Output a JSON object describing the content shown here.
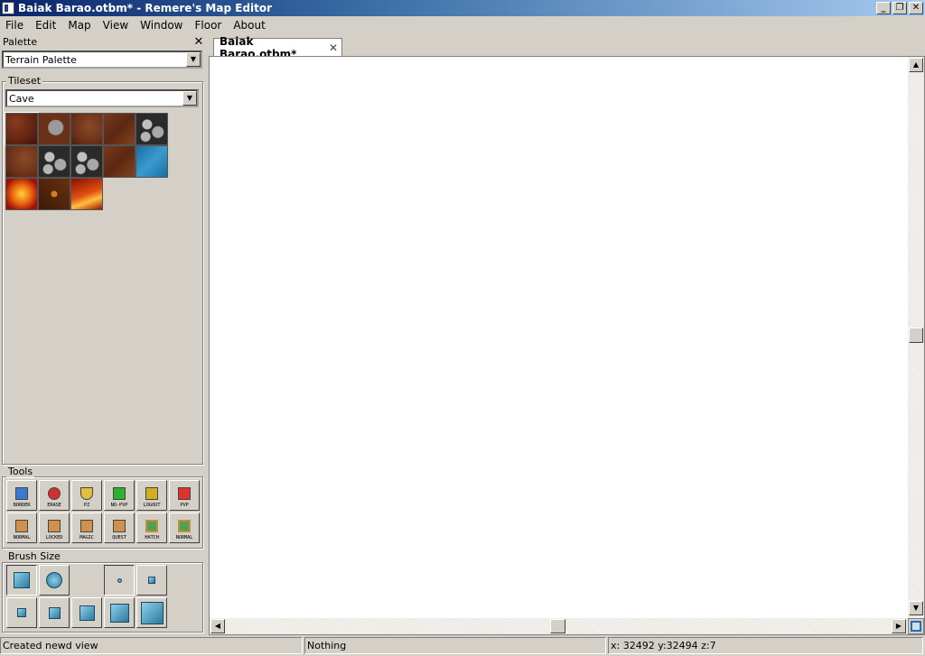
{
  "window": {
    "title": "Baiak Barao.otbm* - Remere's Map Editor",
    "min_glyph": "_",
    "max_glyph": "❐",
    "close_glyph": "✕"
  },
  "menu": [
    "File",
    "Edit",
    "Map",
    "View",
    "Window",
    "Floor",
    "About"
  ],
  "palette": {
    "title": "Palette",
    "close_glyph": "✕",
    "selector_value": "Terrain Palette",
    "tileset_label": "Tileset",
    "tileset_value": "Cave",
    "dropdown_glyph": "▼",
    "tiles": [
      "cave-dirt",
      "cave-rock-dirt",
      "cave-dirt-2",
      "cave-dirt-cracked",
      "cave-rock",
      "cave-dirt-3",
      "cave-rock-2",
      "cave-rock-3",
      "cave-dirt-4",
      "water",
      "lava",
      "lava-cracked",
      "lava-2"
    ]
  },
  "tools": {
    "label": "Tools",
    "buttons": [
      {
        "label": "BORDER",
        "icon": "border-icon",
        "color": "#3a7ad0"
      },
      {
        "label": "ERASE",
        "icon": "eraser-icon",
        "color": "#d03030"
      },
      {
        "label": "PZ",
        "icon": "shield-icon",
        "color": "#e0c040"
      },
      {
        "label": "NO-PVP",
        "icon": "green-flag-icon",
        "color": "#30b030"
      },
      {
        "label": "LOGOUT",
        "icon": "lock-icon",
        "color": "#d0b020"
      },
      {
        "label": "PVP",
        "icon": "red-flag-icon",
        "color": "#e03030"
      },
      {
        "label": "NORMAL",
        "icon": "door-icon",
        "color": "#d09050"
      },
      {
        "label": "LOCKED",
        "icon": "locked-door-icon",
        "color": "#d09050"
      },
      {
        "label": "MAGIC",
        "icon": "magic-door-icon",
        "color": "#d09050"
      },
      {
        "label": "QUEST",
        "icon": "quest-door-icon",
        "color": "#d09050"
      },
      {
        "label": "HATCH",
        "icon": "hatch-window-icon",
        "color": "#50a050"
      },
      {
        "label": "NORMAL",
        "icon": "window-icon",
        "color": "#50a050"
      }
    ]
  },
  "brush_size": {
    "label": "Brush Size"
  },
  "tab": {
    "label": "Baiak Barao.otbm*",
    "close_glyph": "✕"
  },
  "scroll": {
    "up_glyph": "▲",
    "down_glyph": "▼",
    "left_glyph": "◀",
    "right_glyph": "▶"
  },
  "status": {
    "message": "Created newd view",
    "selection": "Nothing",
    "position": "x: 32492 y:32494 z:7"
  }
}
